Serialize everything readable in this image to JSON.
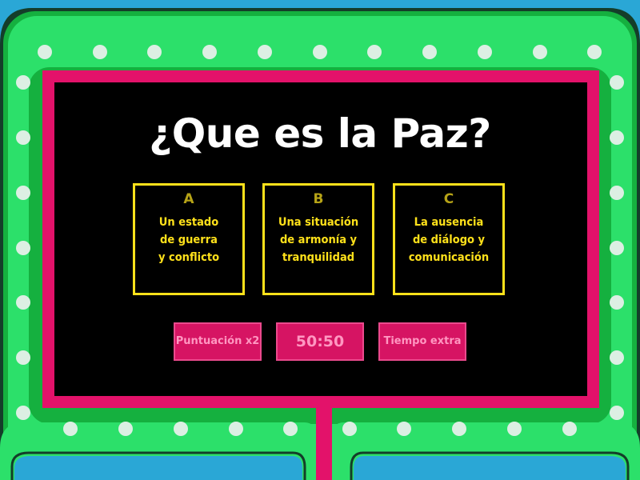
{
  "question": {
    "text": "¿Que es la Paz?"
  },
  "answers": [
    {
      "letter": "A",
      "text": "Un estado\nde guerra\ny conflicto"
    },
    {
      "letter": "B",
      "text": "Una situación\nde armonía y\ntranquilidad"
    },
    {
      "letter": "C",
      "text": "La ausencia\nde diálogo y\ncomunicación"
    }
  ],
  "powerups": [
    {
      "label": "Puntuación x2"
    },
    {
      "label": "50:50"
    },
    {
      "label": "Tiempo extra"
    }
  ],
  "colors": {
    "background": "#2aa7d6",
    "frame_green": "#2ce06a",
    "frame_dark_green": "#15b03f",
    "frame_outline": "#143d2a",
    "bulb": "#dcefe3",
    "screen_border": "#e3126a",
    "screen": "#000000",
    "answer_border": "#ffe11a",
    "answer_letter": "#b6a317",
    "question_text": "#ffffff",
    "powerup_fill": "#d61463",
    "powerup_text": "#ff97c1"
  }
}
